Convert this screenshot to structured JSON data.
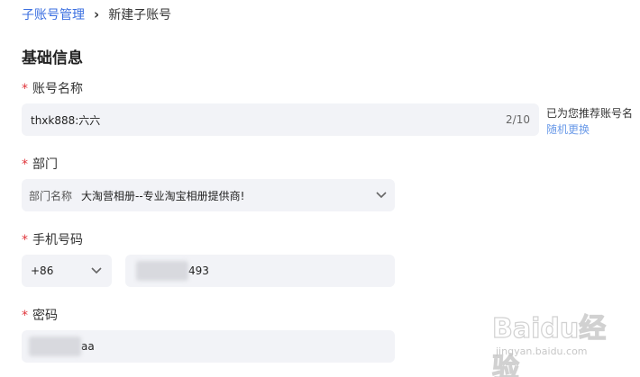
{
  "breadcrumb": {
    "parent": "子账号管理",
    "separator": "›",
    "current": "新建子账号"
  },
  "section": {
    "title": "基础信息"
  },
  "required_mark": "*",
  "account_name": {
    "label": "账号名称",
    "value": "thxk888:六六",
    "counter": "2/10",
    "hint": "已为您推荐账号名",
    "hint_link": "随机更换"
  },
  "department": {
    "label": "部门",
    "prefix": "部门名称",
    "value": "大淘营相册--专业淘宝相册提供商!"
  },
  "phone": {
    "label": "手机号码",
    "country_code": "+86",
    "value_visible_suffix": "493"
  },
  "password": {
    "label": "密码",
    "value_visible_suffix": "aa"
  },
  "watermark": {
    "logo": "Baidu经验",
    "url": "jingyan.baidu.com"
  },
  "colors": {
    "link": "#3b6fe0",
    "required": "#e0353b",
    "field_bg": "#f2f3f7"
  },
  "icons": {
    "breadcrumb_separator": "chevron-right-icon",
    "dropdown": "chevron-down-icon"
  }
}
